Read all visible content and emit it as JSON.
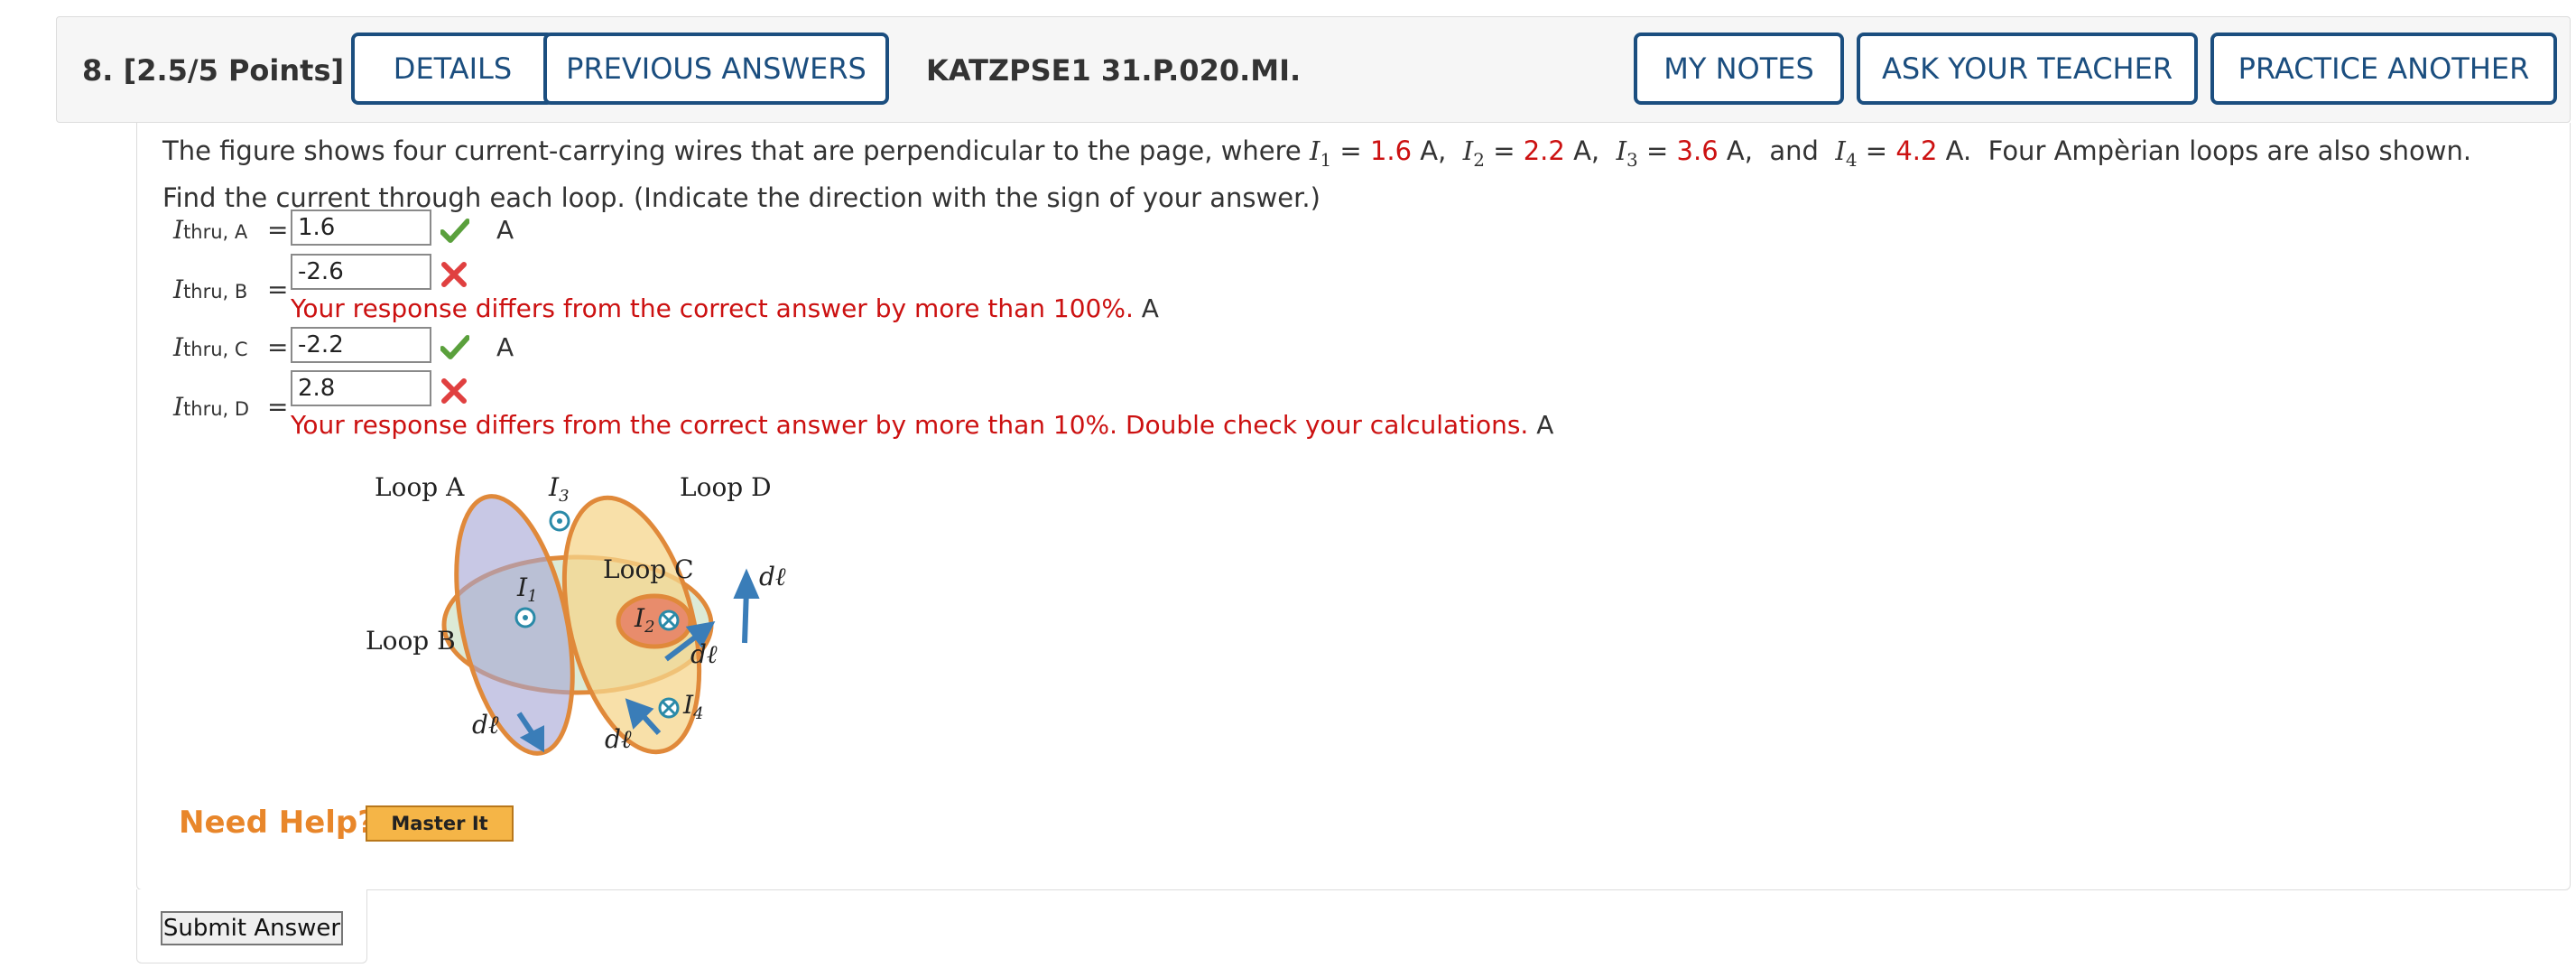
{
  "header": {
    "question_number": "8.  [2.5/5 Points]",
    "details_label": "DETAILS",
    "previous_answers_label": "PREVIOUS ANSWERS",
    "question_code": "KATZPSE1 31.P.020.MI.",
    "my_notes_label": "MY NOTES",
    "ask_teacher_label": "ASK YOUR TEACHER",
    "practice_another_label": "PRACTICE ANOTHER"
  },
  "prompt": {
    "text_before": "The figure shows four current-carrying wires that are perpendicular to the page, where",
    "currents": [
      {
        "symbol": "I",
        "sub": "1",
        "value": "1.6",
        "unit": "A"
      },
      {
        "symbol": "I",
        "sub": "2",
        "value": "2.2",
        "unit": "A"
      },
      {
        "symbol": "I",
        "sub": "3",
        "value": "3.6",
        "unit": "A"
      },
      {
        "symbol": "I",
        "sub": "4",
        "value": "4.2",
        "unit": "A"
      }
    ],
    "and_word": "and",
    "text_after": "Four Ampèrian loops are also shown. Find the current through each loop. (Indicate the direction with the sign of your answer.)"
  },
  "answers": [
    {
      "label_main": "I",
      "label_sub": "thru, A",
      "value": "1.6",
      "status": "correct",
      "unit": "A",
      "feedback": ""
    },
    {
      "label_main": "I",
      "label_sub": "thru, B",
      "value": "-2.6",
      "status": "incorrect",
      "unit": "A",
      "feedback": "Your response differs from the correct answer by more than 100%."
    },
    {
      "label_main": "I",
      "label_sub": "thru, C",
      "value": "-2.2",
      "status": "correct",
      "unit": "A",
      "feedback": ""
    },
    {
      "label_main": "I",
      "label_sub": "thru, D",
      "value": "2.8",
      "status": "incorrect",
      "unit": "A",
      "feedback": "Your response differs from the correct answer by more than 10%. Double check your calculations."
    }
  ],
  "figure": {
    "loop_a": "Loop A",
    "loop_b": "Loop B",
    "loop_c": "Loop C",
    "loop_d": "Loop D",
    "wire_1": "I",
    "wire_1_sub": "1",
    "wire_2": "I",
    "wire_2_sub": "2",
    "wire_3": "I",
    "wire_3_sub": "3",
    "wire_4": "I",
    "wire_4_sub": "4",
    "dl_label": "dℓ"
  },
  "help": {
    "need_help_label": "Need Help?",
    "master_it_label": "Master It"
  },
  "submit_label": "Submit Answer",
  "colors": {
    "button_border": "#1b4e7f",
    "value_red": "#cc1111",
    "correct_green": "#5aa03c",
    "incorrect_red": "#e04040",
    "need_help_orange": "#e8862a"
  }
}
